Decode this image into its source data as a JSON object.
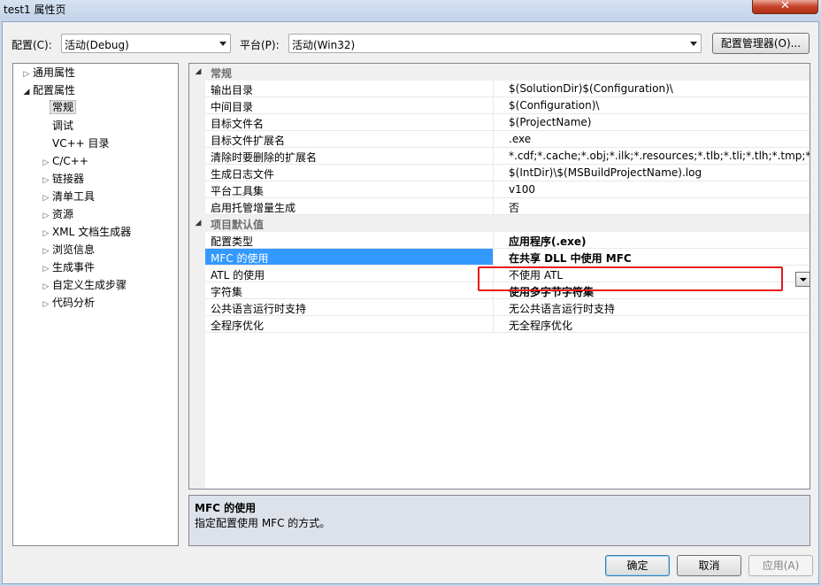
{
  "window": {
    "title": "test1 属性页",
    "close_label": "✕"
  },
  "config": {
    "config_label": "配置(C):",
    "config_value": "活动(Debug)",
    "platform_label": "平台(P):",
    "platform_value": "活动(Win32)",
    "manager_button": "配置管理器(O)..."
  },
  "tree": {
    "items": [
      {
        "label": "通用属性",
        "toggle": "▷"
      },
      {
        "label": "配置属性",
        "toggle": "◢"
      },
      {
        "label": "常规"
      },
      {
        "label": "调试"
      },
      {
        "label": "VC++ 目录"
      },
      {
        "label": "C/C++",
        "toggle": "▷"
      },
      {
        "label": "链接器",
        "toggle": "▷"
      },
      {
        "label": "清单工具",
        "toggle": "▷"
      },
      {
        "label": "资源",
        "toggle": "▷"
      },
      {
        "label": "XML 文档生成器",
        "toggle": "▷"
      },
      {
        "label": "浏览信息",
        "toggle": "▷"
      },
      {
        "label": "生成事件",
        "toggle": "▷"
      },
      {
        "label": "自定义生成步骤",
        "toggle": "▷"
      },
      {
        "label": "代码分析",
        "toggle": "▷"
      }
    ]
  },
  "grid": {
    "categories": [
      {
        "label": "常规",
        "toggle": "◢"
      },
      {
        "label": "项目默认值",
        "toggle": "◢"
      }
    ],
    "general_rows": [
      {
        "name": "输出目录",
        "value": "$(SolutionDir)$(Configuration)\\"
      },
      {
        "name": "中间目录",
        "value": "$(Configuration)\\"
      },
      {
        "name": "目标文件名",
        "value": "$(ProjectName)"
      },
      {
        "name": "目标文件扩展名",
        "value": ".exe"
      },
      {
        "name": "清除时要删除的扩展名",
        "value": "*.cdf;*.cache;*.obj;*.ilk;*.resources;*.tlb;*.tli;*.tlh;*.tmp;*.rsp;*.pgc"
      },
      {
        "name": "生成日志文件",
        "value": "$(IntDir)\\$(MSBuildProjectName).log"
      },
      {
        "name": "平台工具集",
        "value": "v100"
      },
      {
        "name": "启用托管增量生成",
        "value": "否"
      }
    ],
    "defaults_rows": [
      {
        "name": "配置类型",
        "value": "应用程序(.exe)"
      },
      {
        "name": "MFC 的使用",
        "value": "在共享 DLL 中使用 MFC"
      },
      {
        "name": "ATL 的使用",
        "value": "不使用 ATL"
      },
      {
        "name": "字符集",
        "value": "使用多字节字符集"
      },
      {
        "name": "公共语言运行时支持",
        "value": "无公共语言运行时支持"
      },
      {
        "name": "全程序优化",
        "value": "无全程序优化"
      }
    ]
  },
  "description": {
    "title": "MFC 的使用",
    "text": "指定配置使用 MFC 的方式。"
  },
  "buttons": {
    "ok": "确定",
    "cancel": "取消",
    "apply": "应用(A)"
  },
  "colors": {
    "selection": "#3399ff",
    "highlight": "#e8161b"
  }
}
